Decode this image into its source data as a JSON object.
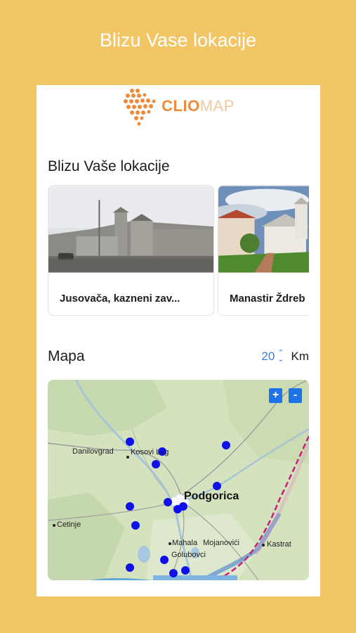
{
  "promo": {
    "title": "Blizu Vase lokacije"
  },
  "logo": {
    "part1": "CLIO",
    "part2": "MAP"
  },
  "nearby": {
    "title": "Blizu Vaše lokacije",
    "cards": [
      {
        "label": "Jusovača, kazneni zav..."
      },
      {
        "label": "Manastir Ždreb"
      }
    ]
  },
  "map_section": {
    "title": "Mapa",
    "radius_value": "20",
    "radius_unit": "Km",
    "zoom_in": "+",
    "zoom_out": "-",
    "places": {
      "danilovgrad": "Danilovgrad",
      "kosovi_lug": "Kosovi Lug",
      "podgorica": "Podgorica",
      "cetinje": "Cetinje",
      "mahala": "Mahala",
      "mojanovici": "Mojanovići",
      "golubovci": "Golubovci",
      "kastrat": "Kastrat"
    }
  },
  "colors": {
    "background": "#f2c565",
    "accent": "#2f7fe0",
    "marker": "#1010e8",
    "logo_orange": "#ee8a3a"
  }
}
